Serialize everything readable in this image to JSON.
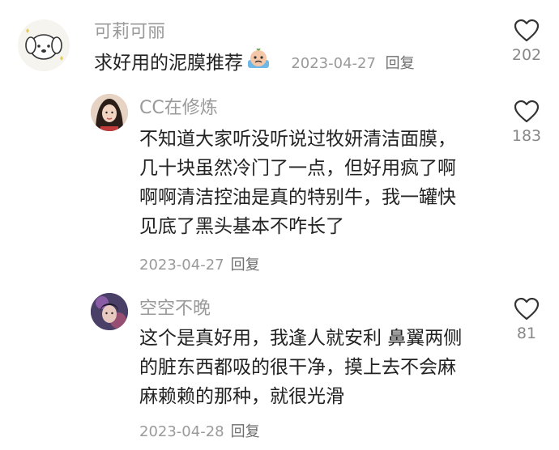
{
  "comments": [
    {
      "username": "可莉可丽",
      "lines": [
        "求好用的泥膜推荐"
      ],
      "emoji": "crying-face-emoji",
      "inline_date": "2023-04-27",
      "inline_reply": "回复",
      "likes": "202"
    },
    {
      "username": "CC在修炼",
      "lines": [
        "不知道大家听没听说过牧妍清洁面膜，",
        "几十块虽然冷门了一点，但好用疯了啊",
        "啊啊清洁控油是真的特别牛，我一罐快",
        "见底了黑头基本不咋长了"
      ],
      "date": "2023-04-27",
      "reply": "回复",
      "likes": "183"
    },
    {
      "username": "空空不晚",
      "lines": [
        "这个是真好用，我逢人就安利 鼻翼两侧",
        "的脏东西都吸的很干净，摸上去不会麻",
        "麻赖赖的那种，就很光滑"
      ],
      "date": "2023-04-28",
      "reply": "回复",
      "likes": "81"
    }
  ],
  "icons": {
    "like": "heart-outline-icon"
  },
  "colors": {
    "username": "#9a9a9a",
    "text": "#222222",
    "meta": "#9a9a9a",
    "heart": "#333333"
  }
}
